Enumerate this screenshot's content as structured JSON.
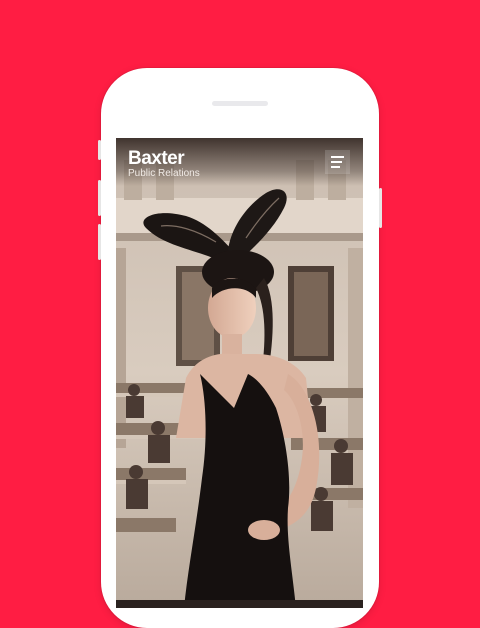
{
  "app": {
    "brand": "Baxter",
    "tagline": "Public Relations"
  },
  "header": {
    "menu_icon": "hamburger-menu-icon"
  },
  "colors": {
    "background": "#ff1d43",
    "device": "#ffffff",
    "header_overlay": "#281c18"
  },
  "hero": {
    "image": "model-in-black-dress-with-feather-bunny-ears-vintage-office"
  }
}
